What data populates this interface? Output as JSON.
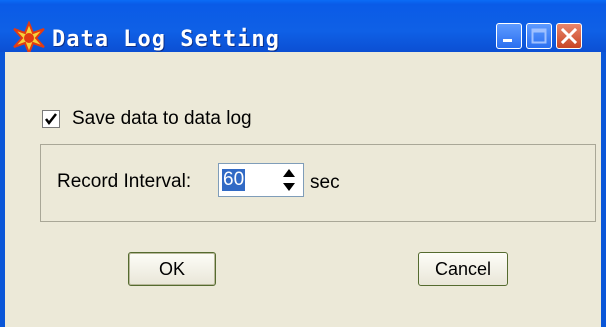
{
  "window": {
    "title": "Data Log Setting",
    "accent_color": "#0a56d8",
    "close_color": "#d9532f"
  },
  "titlebar_buttons": [
    {
      "name": "minimize",
      "icon": "minimize-icon"
    },
    {
      "name": "maximize",
      "icon": "maximize-icon"
    },
    {
      "name": "close",
      "icon": "close-icon"
    }
  ],
  "options": {
    "save_log": {
      "label": "Save data to data log",
      "checked": true,
      "icon": "checkmark-icon"
    }
  },
  "record_interval": {
    "label": "Record Interval:",
    "value": "60",
    "unit": "sec",
    "icons": [
      "spin-up-icon",
      "spin-down-icon"
    ]
  },
  "buttons": {
    "ok": "OK",
    "cancel": "Cancel"
  }
}
